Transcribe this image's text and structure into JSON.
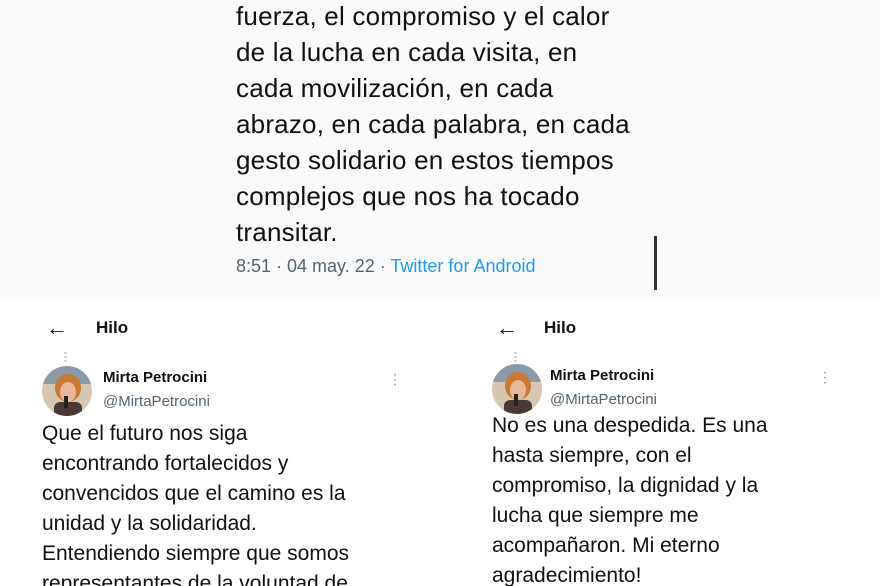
{
  "top_tweet": {
    "lines": [
      "fuerza, el compromiso y el calor",
      "de la lucha en cada visita, en",
      "cada movilización, en cada",
      "abrazo, en cada palabra, en cada",
      "gesto solidario en estos tiempos",
      "complejos que nos ha tocado",
      "transitar."
    ],
    "time": "8:51 · 04 may. 22 · ",
    "source": "Twitter for Android"
  },
  "left_thread": {
    "back_icon": "←",
    "title": "Hilo",
    "author_name": "Mirta Petrocini",
    "author_handle": "@MirtaPetrocini",
    "more_icon": "⋮",
    "lines": [
      "Que el futuro nos siga",
      "encontrando fortalecidos y",
      "convencidos que el camino es la",
      "unidad y la solidaridad.",
      "Entendiendo siempre que somos",
      "representantes de la voluntad de"
    ]
  },
  "right_thread": {
    "back_icon": "←",
    "title": "Hilo",
    "author_name": "Mirta Petrocini",
    "author_handle": "@MirtaPetrocini",
    "more_icon": "⋮",
    "lines": [
      "No es una despedida. Es una",
      "hasta siempre, con el",
      "compromiso, la dignidad y la",
      "lucha que siempre me",
      "acompañaron. Mi eterno",
      "agradecimiento!"
    ]
  },
  "colors": {
    "accent": "#1d9bf0",
    "muted": "#536471"
  }
}
